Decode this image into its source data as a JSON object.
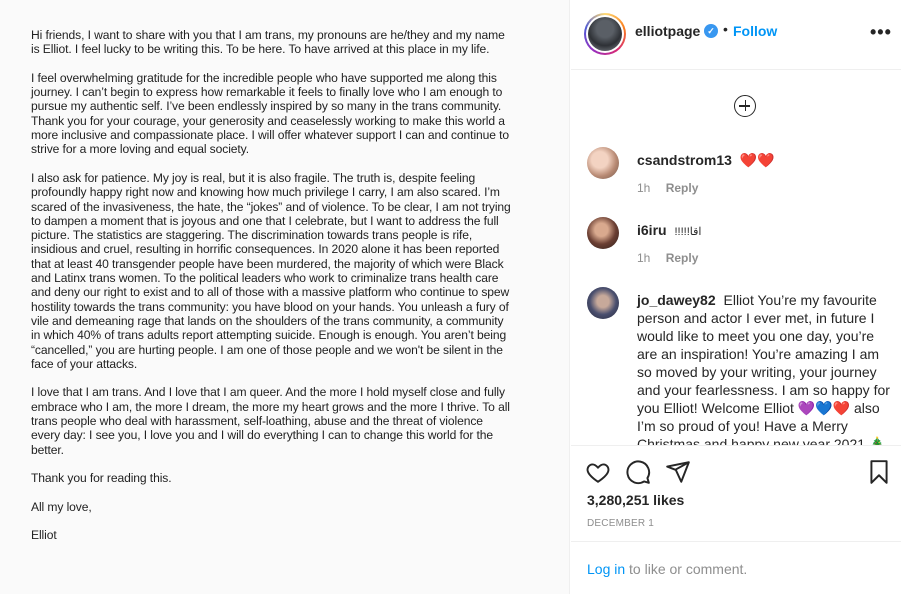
{
  "post": {
    "letter_paragraphs": [
      "Hi friends, I want to share with you that I am trans, my pronouns are he/they and my name is Elliot. I feel lucky to be writing this. To be here. To have arrived at this place in my life.",
      "I feel overwhelming gratitude for the incredible people who have supported me along this journey. I can’t begin to express how remarkable it feels to finally love who I am enough to pursue my authentic self. I’ve been endlessly inspired by so many in the trans community. Thank you for your courage, your generosity and ceaselessly working to make this world a more inclusive and compassionate place. I will offer whatever support I can and continue to strive for a more loving and equal society.",
      "I also ask for patience. My joy is real, but it is also fragile. The truth is, despite feeling profoundly happy right now and knowing how much privilege I carry, I am also scared. I’m scared of the invasiveness, the hate, the “jokes” and of violence. To be clear, I am not trying to dampen a moment that is joyous and one that I celebrate, but I want to address the full picture. The statistics are staggering. The discrimination towards trans people is rife, insidious and cruel, resulting in horrific consequences. In 2020 alone it has been reported that at least 40 transgender people have been murdered, the majority of which were Black and Latinx trans women. To the political leaders who work to criminalize trans health care and deny our right to exist and to all of those with a massive platform who continue to spew hostility towards the trans community: you have blood on your hands. You unleash a fury of vile and demeaning rage that lands on the shoulders of the trans community, a community in which 40% of trans adults report attempting suicide. Enough is enough. You aren’t being “cancelled,” you are hurting people. I am one of those people and we won't be silent in the face of your attacks.",
      "I love that I am trans. And I love that I am queer. And the more I hold myself close and fully embrace who I am, the more I dream, the more my heart grows and the more I thrive. To all trans people who deal with harassment, self-loathing, abuse and the threat of violence every day: I see you, I love you and I will do everything I can to change this world for the better.",
      "Thank you for reading this.",
      "All my love,",
      "Elliot"
    ]
  },
  "header": {
    "username": "elliotpage",
    "verified_glyph": "✓",
    "separator": "•",
    "follow_label": "Follow",
    "more_label": "•••"
  },
  "comments": [
    {
      "user": "csandstrom13",
      "text": "❤️❤️",
      "time": "1h",
      "reply_label": "Reply"
    },
    {
      "user": "i6iru",
      "text": "!!!!!اقا",
      "time": "1h",
      "reply_label": "Reply"
    },
    {
      "user": "jo_dawey82",
      "text": "Elliot You’re my favourite person and actor I ever met, in future I would like to meet you one day, you’re are an inspiration! You’re amazing I am so moved by your writing, your journey and your fearlessness. I am so happy for you Elliot! Welcome Elliot 💜💙❤️ also I’m so proud of you! Have a Merry Christmas and happy new year 2021 🎄"
    }
  ],
  "actions": {
    "likes": "3,280,251 likes",
    "date": "DECEMBER 1"
  },
  "login": {
    "link_label": "Log in",
    "suffix": " to like or comment."
  },
  "icons": {
    "load_more": "plus-circle-icon",
    "like": "heart-icon",
    "comment": "comment-icon",
    "share": "share-icon",
    "save": "bookmark-icon"
  }
}
